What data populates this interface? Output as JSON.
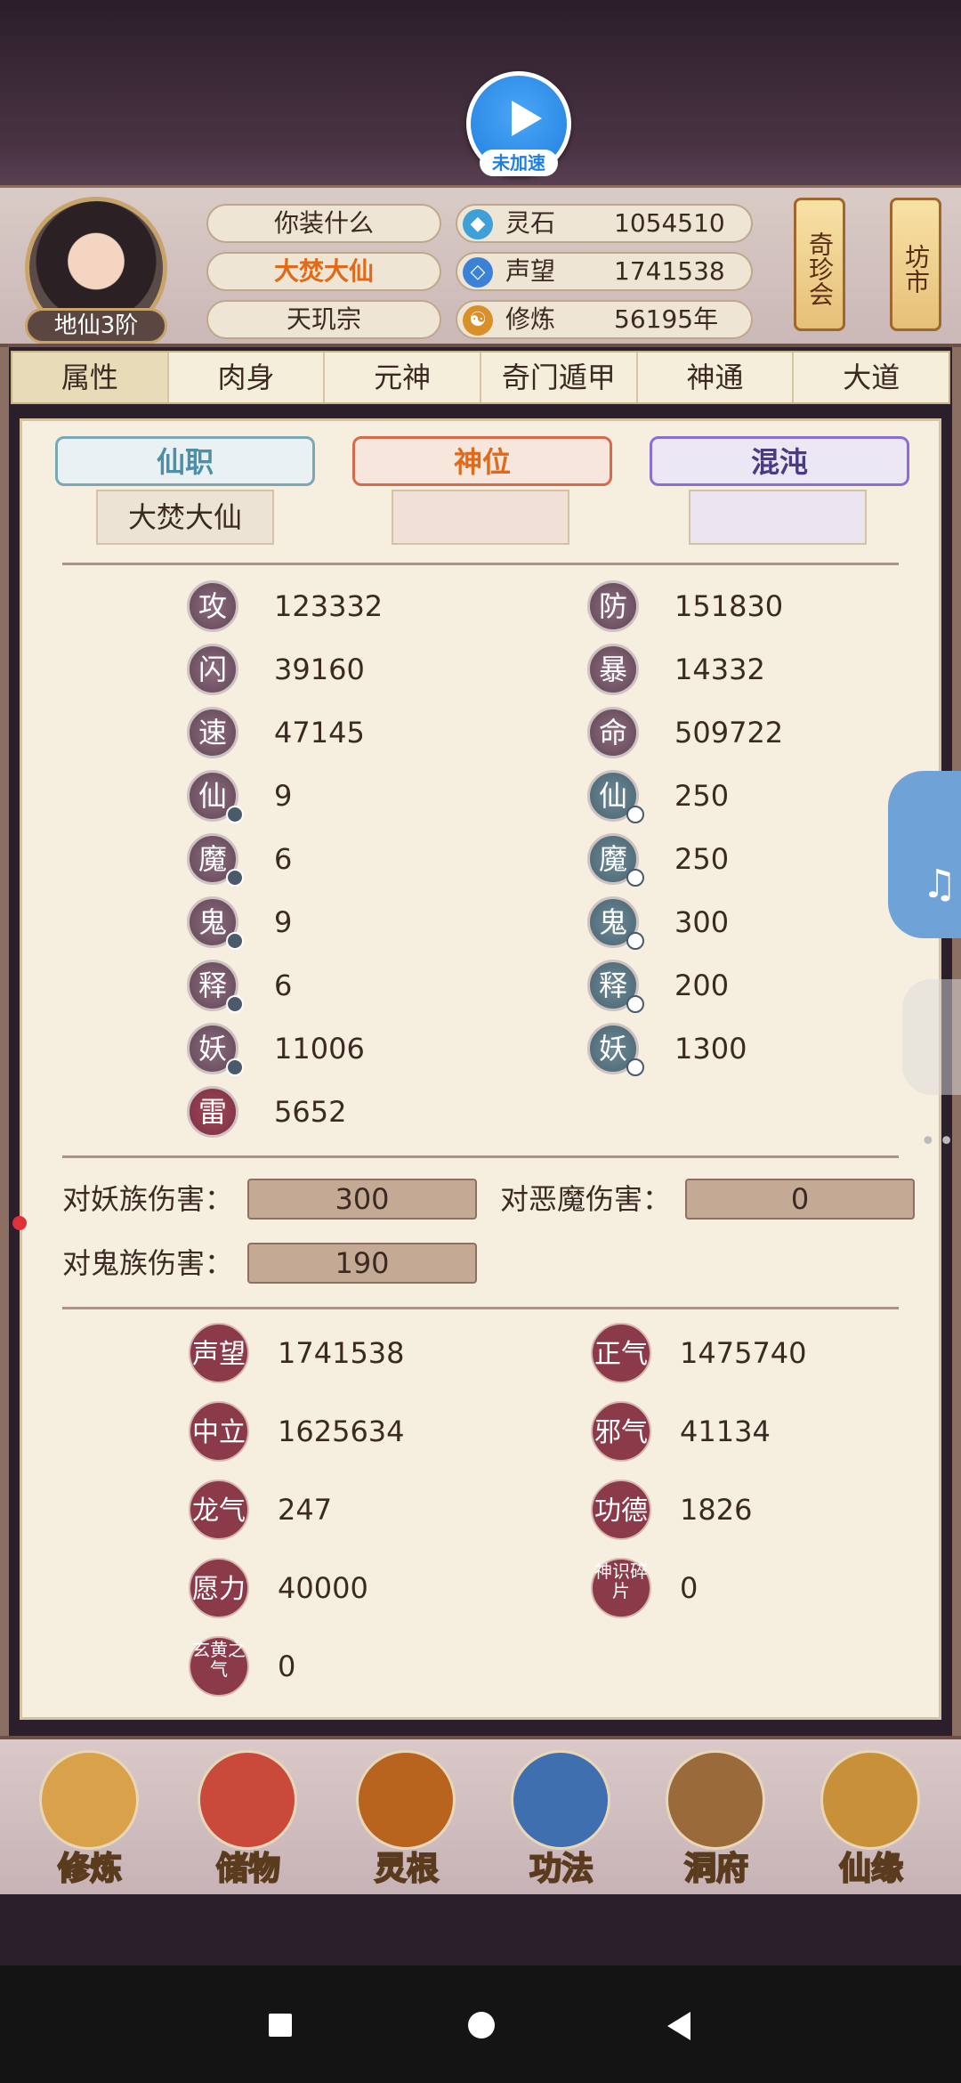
{
  "speed_button": {
    "label": "未加速"
  },
  "player": {
    "rank": "地仙3阶"
  },
  "info_rows": [
    "你装什么",
    "大焚大仙",
    "天玑宗"
  ],
  "resources": [
    {
      "name": "灵石",
      "value": "1054510",
      "icon": "spirit-stone-icon",
      "color": "#3fa0d8"
    },
    {
      "name": "声望",
      "value": "1741538",
      "icon": "reputation-icon",
      "color": "#3b82d6"
    },
    {
      "name": "修炼",
      "value": "56195年",
      "icon": "cultivation-icon",
      "color": "#d9902a"
    }
  ],
  "shops": [
    {
      "label": "奇珍会"
    },
    {
      "label": "坊市"
    }
  ],
  "tabs": [
    "属性",
    "肉身",
    "元神",
    "奇门遁甲",
    "神通",
    "大道"
  ],
  "banners": [
    {
      "label": "仙职",
      "slot": "大焚大仙"
    },
    {
      "label": "神位",
      "slot": ""
    },
    {
      "label": "混沌",
      "slot": ""
    }
  ],
  "attributes_left": [
    {
      "badge": "攻",
      "value": "123332"
    },
    {
      "badge": "闪",
      "value": "39160"
    },
    {
      "badge": "速",
      "value": "47145"
    },
    {
      "badge": "仙",
      "value": "9"
    },
    {
      "badge": "魔",
      "value": "6"
    },
    {
      "badge": "鬼",
      "value": "9"
    },
    {
      "badge": "释",
      "value": "6"
    },
    {
      "badge": "妖",
      "value": "11006"
    },
    {
      "badge": "雷",
      "value": "5652"
    }
  ],
  "attributes_right": [
    {
      "badge": "防",
      "value": "151830"
    },
    {
      "badge": "暴",
      "value": "14332"
    },
    {
      "badge": "命",
      "value": "509722"
    },
    {
      "badge": "仙",
      "value": "250"
    },
    {
      "badge": "魔",
      "value": "250"
    },
    {
      "badge": "鬼",
      "value": "300"
    },
    {
      "badge": "释",
      "value": "200"
    },
    {
      "badge": "妖",
      "value": "1300"
    }
  ],
  "damage": [
    {
      "label": "对妖族伤害：",
      "value": "300"
    },
    {
      "label": "对恶魔伤害：",
      "value": "0"
    },
    {
      "label": "对鬼族伤害：",
      "value": "190"
    }
  ],
  "reputation": [
    {
      "name": "声望",
      "value": "1741538"
    },
    {
      "name": "正气",
      "value": "1475740"
    },
    {
      "name": "中立",
      "value": "1625634"
    },
    {
      "name": "邪气",
      "value": "41134"
    },
    {
      "name": "龙气",
      "value": "247"
    },
    {
      "name": "功德",
      "value": "1826"
    },
    {
      "name": "愿力",
      "value": "40000"
    },
    {
      "name": "神识碎片",
      "value": "0"
    },
    {
      "name": "玄黄之气",
      "value": "0"
    }
  ],
  "bottom_nav": [
    "修炼",
    "储物",
    "灵根",
    "功法",
    "洞府",
    "仙缘"
  ]
}
